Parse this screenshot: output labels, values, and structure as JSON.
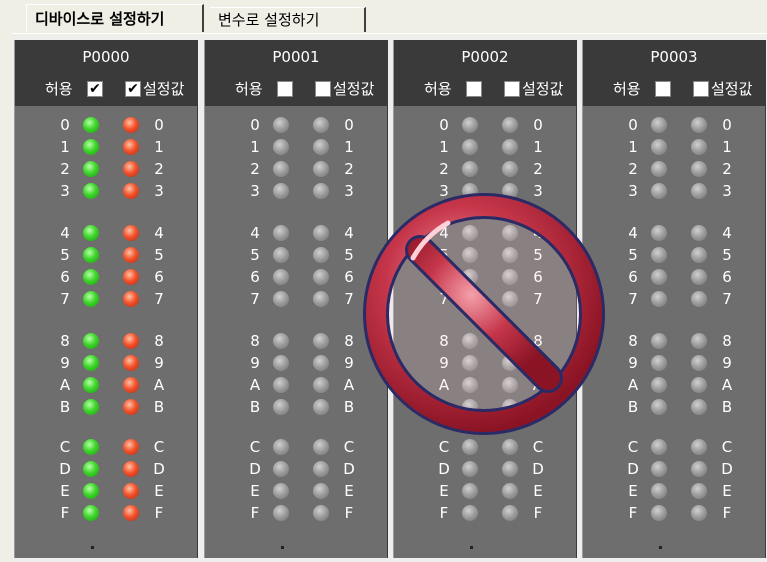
{
  "tabs": [
    {
      "label": "디바이스로 설정하기",
      "active": true
    },
    {
      "label": "변수로 설정하기",
      "active": false
    }
  ],
  "panels": [
    {
      "title": "P0000",
      "allow_label": "허용",
      "allow_checked": true,
      "setvalue_label": "설정값",
      "setvalue_checked": true,
      "state": "active"
    },
    {
      "title": "P0001",
      "allow_label": "허용",
      "allow_checked": false,
      "setvalue_label": "설정값",
      "setvalue_checked": false,
      "state": "inactive"
    },
    {
      "title": "P0002",
      "allow_label": "허용",
      "allow_checked": false,
      "setvalue_label": "설정값",
      "setvalue_checked": false,
      "state": "inactive"
    },
    {
      "title": "P0003",
      "allow_label": "허용",
      "allow_checked": false,
      "setvalue_label": "설정값",
      "setvalue_checked": false,
      "state": "inactive"
    }
  ],
  "bits": [
    "0",
    "1",
    "2",
    "3",
    "4",
    "5",
    "6",
    "7",
    "8",
    "9",
    "A",
    "B",
    "C",
    "D",
    "E",
    "F"
  ],
  "check_mark": "✔",
  "colors": {
    "allow_on": "#3ed62a",
    "value_on": "#f2542c",
    "off": "#9a9a9a",
    "prohibited": "#c0283c"
  },
  "overlay_icon": "prohibited-icon"
}
